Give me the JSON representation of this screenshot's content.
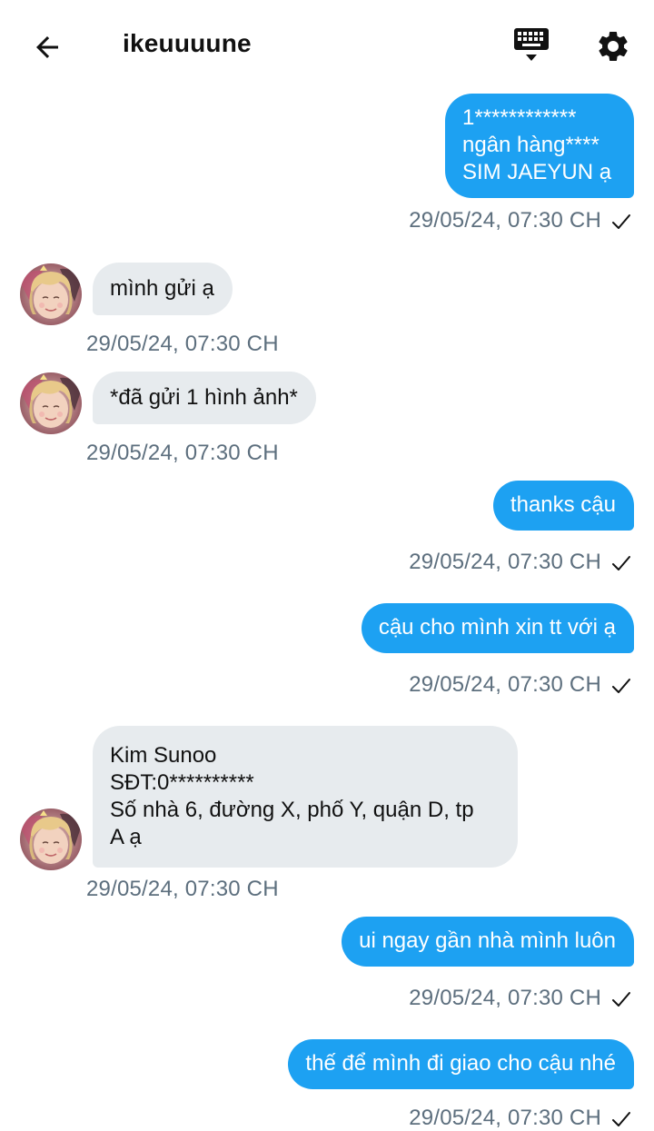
{
  "header": {
    "title": "ikeuuuune",
    "back_icon": "arrow-left-icon",
    "keyboard_icon": "keyboard-icon",
    "settings_icon": "gear-icon"
  },
  "colors": {
    "outgoing_bubble": "#1da1f2",
    "incoming_bubble": "#e7ebee",
    "timestamp": "#5d6f7e"
  },
  "messages": [
    {
      "direction": "out",
      "text": "1************\nngân hàng****\nSIM JAEYUN ạ",
      "time": "29/05/24, 07:30 CH",
      "read": true
    },
    {
      "direction": "in",
      "text": "mình gửi ạ",
      "time": "29/05/24, 07:30 CH"
    },
    {
      "direction": "in",
      "text": "*đã gửi 1 hình ảnh*",
      "time": "29/05/24, 07:30 CH"
    },
    {
      "direction": "out",
      "text": "thanks cậu",
      "time": "29/05/24, 07:30 CH",
      "read": true
    },
    {
      "direction": "out",
      "text": "cậu cho mình xin tt với ạ",
      "time": "29/05/24, 07:30 CH",
      "read": true
    },
    {
      "direction": "in",
      "text": "Kim Sunoo\nSĐT:0**********\nSố nhà 6, đường X, phố Y, quận D, tp\nA ạ",
      "time": "29/05/24, 07:30 CH"
    },
    {
      "direction": "out",
      "text": "ui ngay gần nhà mình luôn",
      "time": "29/05/24, 07:30 CH",
      "read": true
    },
    {
      "direction": "out",
      "text": "thế để mình đi giao cho cậu nhé",
      "time": "29/05/24, 07:30 CH",
      "read": true
    }
  ]
}
